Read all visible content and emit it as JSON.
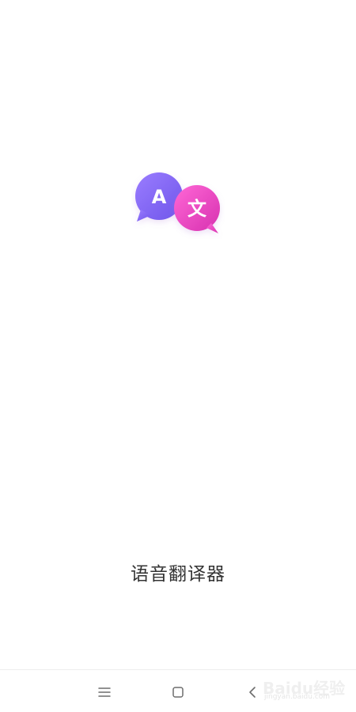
{
  "app": {
    "name": "语音翻译器",
    "logo": {
      "left_bubble_letter": "A",
      "right_bubble_char": "文",
      "left_bubble_color": "#7f63f2",
      "right_bubble_color": "#ea4bbf"
    }
  },
  "nav_bar": {
    "menu_icon": "menu-icon",
    "home_icon": "home-square-icon",
    "back_icon": "back-chevron-icon"
  },
  "watermark": {
    "brand": "Baidu经验",
    "url": "jingyan.baidu.com"
  }
}
